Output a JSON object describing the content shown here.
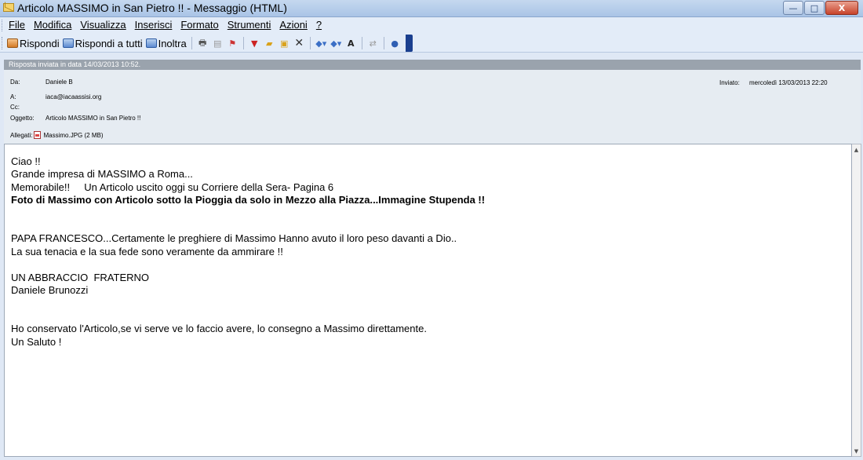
{
  "window": {
    "title": "Articolo MASSIMO in San Pietro !! - Messaggio (HTML)",
    "controls": {
      "minimize": "—",
      "maximize": "□",
      "close": "X"
    }
  },
  "menu": [
    "File",
    "Modifica",
    "Visualizza",
    "Inserisci",
    "Formato",
    "Strumenti",
    "Azioni",
    "?"
  ],
  "toolbar": {
    "reply_label": "Rispondi",
    "reply_all_label": "Rispondi a tutti",
    "forward_label": "Inoltra",
    "icons": [
      "print-icon",
      "move-folder-icon",
      "flag-icon",
      "categorize-icon",
      "folder-icon",
      "address-book-icon",
      "delete-icon",
      "previous-icon",
      "next-icon",
      "font-size-icon",
      "encoding-icon",
      "help-icon"
    ]
  },
  "info_bar": "Risposta inviata in data 14/03/2013 10:52.",
  "headers": {
    "from_label": "Da:",
    "from_value": "Daniele B",
    "to_label": "A:",
    "to_value": "iaca@iacaassisi.org",
    "cc_label": "Cc:",
    "cc_value": "",
    "subject_label": "Oggetto:",
    "subject_value": "Articolo MASSIMO in San Pietro !!",
    "sent_label": "Inviato:",
    "sent_value": "mercoledì 13/03/2013 22:20",
    "attachments_label": "Allegati:",
    "attachment_name": "Massimo.JPG (2 MB)"
  },
  "body": {
    "line1": "Ciao !!",
    "line2": "Grande impresa di MASSIMO a Roma...",
    "line3": "Memorabile!!     Un Articolo uscito oggi su Corriere della Sera- Pagina 6",
    "line4": "Foto di Massimo con Articolo sotto la Pioggia da solo in Mezzo alla Piazza...Immagine Stupenda !!",
    "line5": "PAPA FRANCESCO...Certamente le preghiere di Massimo Hanno avuto il loro peso davanti a Dio..",
    "line6": "La sua tenacia e la sua fede sono veramente da ammirare !!",
    "line7": "UN ABBRACCIO  FRATERNO",
    "line8": "Daniele Brunozzi",
    "line9": "Ho conservato l'Articolo,se vi serve ve lo faccio avere, lo consegno a Massimo direttamente.",
    "line10": "Un Saluto !"
  }
}
